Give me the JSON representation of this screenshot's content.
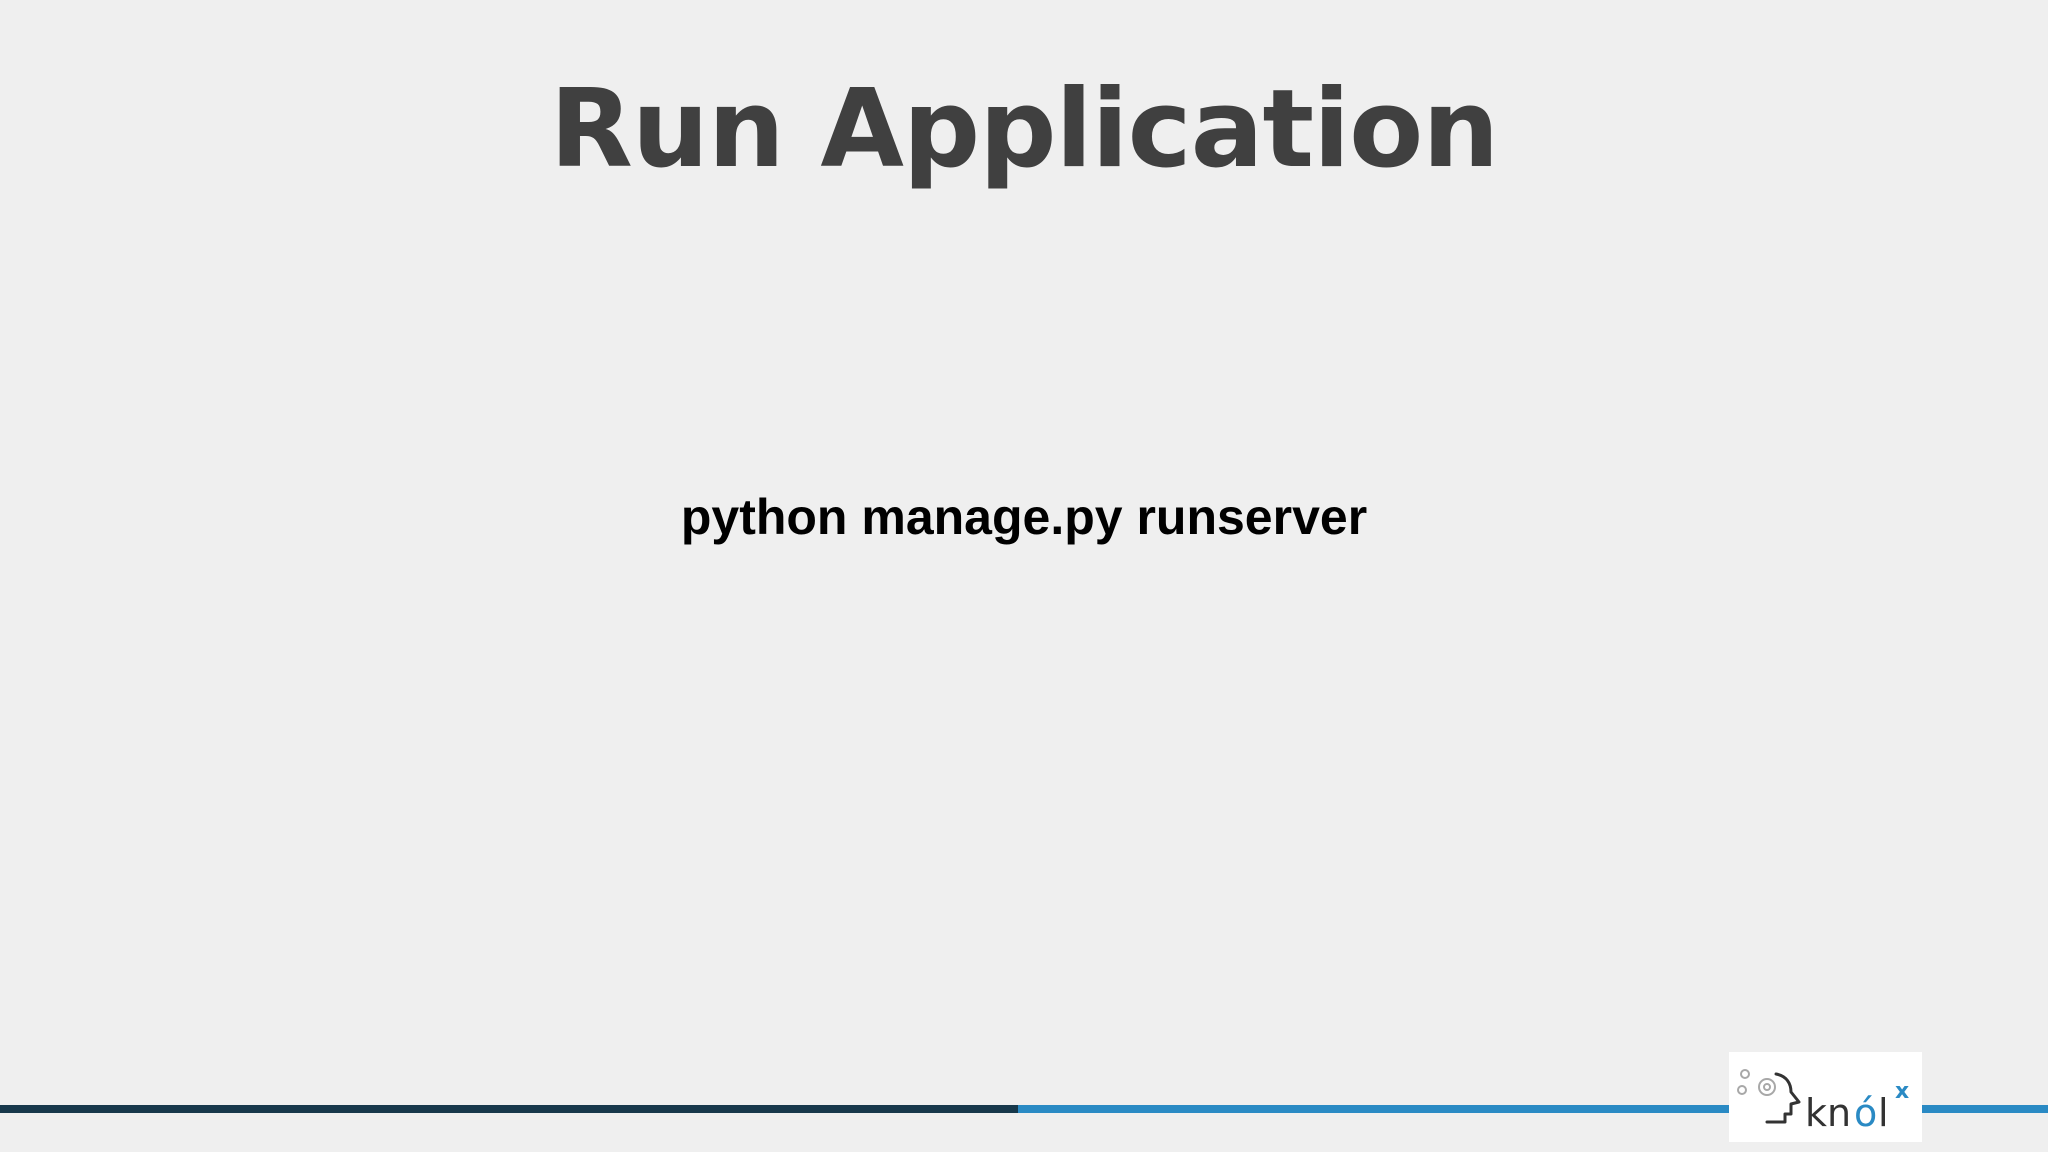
{
  "slide": {
    "title": "Run Application",
    "command": "python manage.py runserver"
  },
  "footer": {
    "logo": {
      "brand": "knólx",
      "icon": "head-gears-icon"
    },
    "colors": {
      "bar_dark": "#17384b",
      "bar_blue": "#2a8ac4"
    }
  },
  "colors": {
    "background": "#efefef",
    "title": "#404040",
    "body_text": "#000000"
  }
}
